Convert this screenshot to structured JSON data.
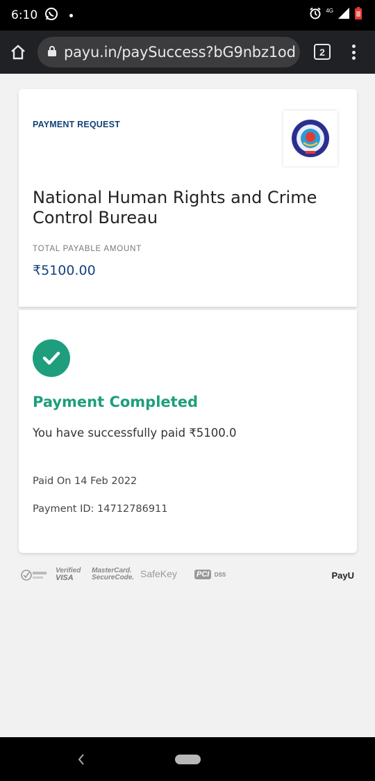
{
  "status_bar": {
    "time": "6:10",
    "network": "4G"
  },
  "browser": {
    "url": "payu.in/paySuccess?bG9nbz1od",
    "tab_count": "2"
  },
  "payment": {
    "request_label": "PAYMENT REQUEST",
    "merchant_name": "National Human Rights and Crime Control Bureau",
    "amount_label": "TOTAL PAYABLE AMOUNT",
    "amount": "₹5100.00",
    "status_title": "Payment Completed",
    "success_message": "You have successfully paid ₹5100.0",
    "paid_on": "Paid On 14 Feb 2022",
    "payment_id": "Payment ID: 14712786911"
  },
  "trust_badges": {
    "verified_line1": "Verified",
    "verified_line2": "VISA",
    "mastercard_line1": "MasterCard.",
    "mastercard_line2": "SecureCode.",
    "safekey": "SafeKey",
    "pci": "PCI",
    "dss": "DSS",
    "payu": "PayU"
  },
  "colors": {
    "accent_blue": "#13427a",
    "success_green": "#1e9e7d"
  },
  "icons": [
    "whatsapp-icon",
    "alarm-icon",
    "signal-icon",
    "battery-icon",
    "home-icon",
    "lock-icon",
    "menu-icon",
    "check-icon",
    "back-icon"
  ]
}
